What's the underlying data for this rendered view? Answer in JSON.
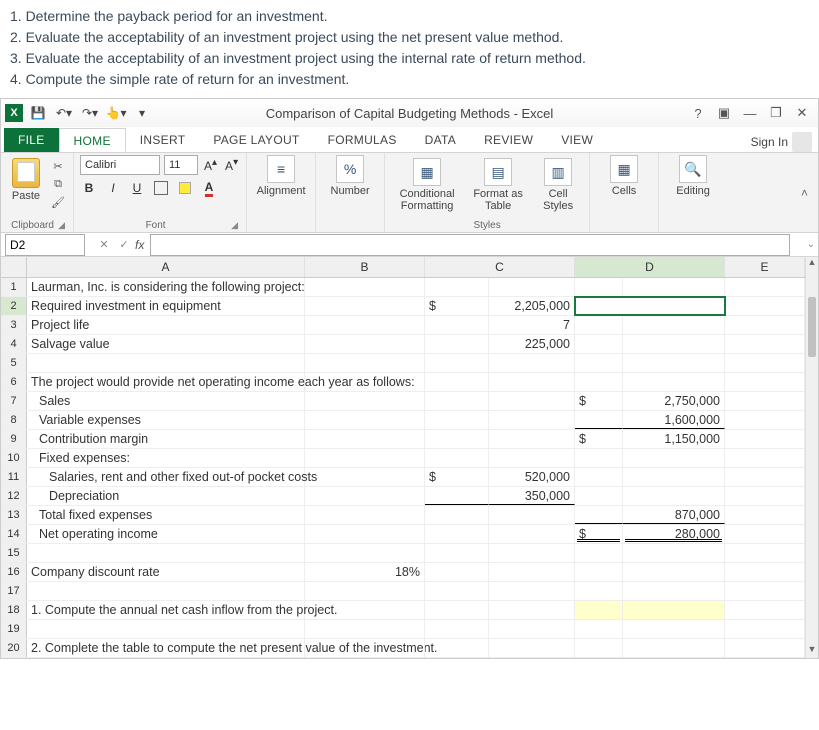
{
  "questions": {
    "q1": "1. Determine the payback period for an investment.",
    "q2": "2. Evaluate the acceptability of an investment project using the net present value method.",
    "q3": "3. Evaluate the acceptability of an investment project using the internal rate of return method.",
    "q4": "4. Compute the simple rate of return for an investment."
  },
  "window": {
    "title": "Comparison of Capital Budgeting Methods - Excel",
    "help": "?",
    "signIn": "Sign In"
  },
  "tabs": {
    "file": "FILE",
    "home": "HOME",
    "insert": "INSERT",
    "pageLayout": "PAGE LAYOUT",
    "formulas": "FORMULAS",
    "data": "DATA",
    "review": "REVIEW",
    "view": "VIEW"
  },
  "ribbon": {
    "paste": "Paste",
    "clipboard": "Clipboard",
    "fontName": "Calibri",
    "fontSize": "11",
    "font": "Font",
    "alignment": "Alignment",
    "number": "Number",
    "percent": "%",
    "condFmt": "Conditional Formatting",
    "fmtTable": "Format as Table",
    "cellStyles": "Cell Styles",
    "styles": "Styles",
    "cells": "Cells",
    "editing": "Editing"
  },
  "nameBox": "D2",
  "cols": {
    "A": "A",
    "B": "B",
    "C": "C",
    "D": "D",
    "E": "E"
  },
  "rows": {
    "r1": {
      "n": "1",
      "A": "Laurman, Inc. is considering the following project:"
    },
    "r2": {
      "n": "2",
      "A": "Required investment in equipment",
      "Cs": "$",
      "Cv": "2,205,000"
    },
    "r3": {
      "n": "3",
      "A": "Project life",
      "Cv": "7"
    },
    "r4": {
      "n": "4",
      "A": "Salvage value",
      "Cv": "225,000"
    },
    "r5": {
      "n": "5"
    },
    "r6": {
      "n": "6",
      "A": "The project would provide net operating income each year as follows:"
    },
    "r7": {
      "n": "7",
      "A": "Sales",
      "Ds": "$",
      "Dv": "2,750,000"
    },
    "r8": {
      "n": "8",
      "A": "Variable expenses",
      "Dv": "1,600,000"
    },
    "r9": {
      "n": "9",
      "A": "Contribution margin",
      "Ds": "$",
      "Dv": "1,150,000"
    },
    "r10": {
      "n": "10",
      "A": "Fixed expenses:"
    },
    "r11": {
      "n": "11",
      "A": "Salaries, rent and other fixed out-of pocket costs",
      "Cs": "$",
      "Cv": "520,000"
    },
    "r12": {
      "n": "12",
      "A": "Depreciation",
      "Cv": "350,000"
    },
    "r13": {
      "n": "13",
      "A": "Total fixed expenses",
      "Dv": "870,000"
    },
    "r14": {
      "n": "14",
      "A": "Net operating income",
      "Ds": "$",
      "Dv": "280,000"
    },
    "r15": {
      "n": "15"
    },
    "r16": {
      "n": "16",
      "A": "Company discount rate",
      "B": "18%"
    },
    "r17": {
      "n": "17"
    },
    "r18": {
      "n": "18",
      "A": "1. Compute the annual net cash inflow from the project."
    },
    "r19": {
      "n": "19"
    },
    "r20": {
      "n": "20",
      "A": "2. Complete the table to compute the net present value of the investment."
    }
  }
}
